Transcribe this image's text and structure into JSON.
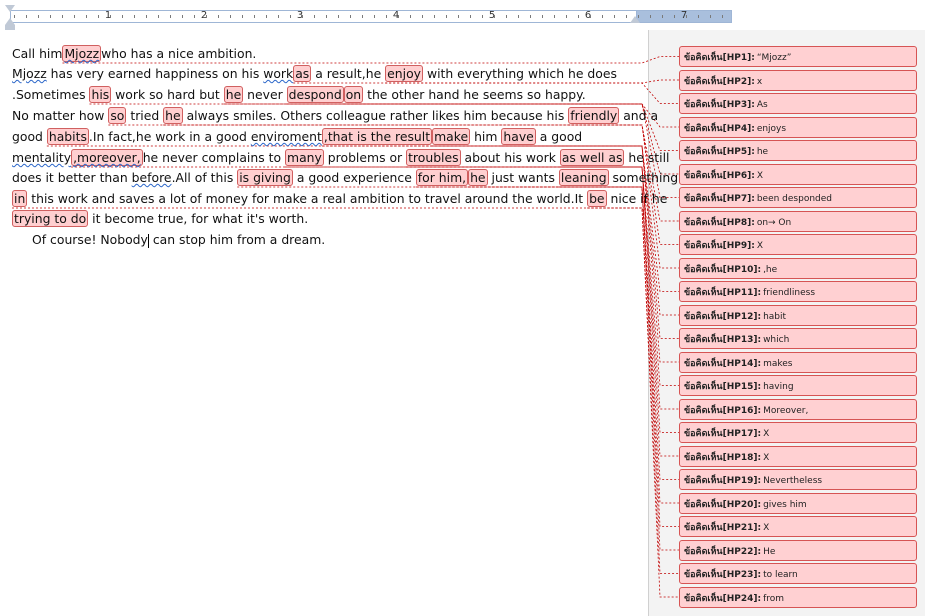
{
  "ruler": {
    "numbers": [
      "1",
      "2",
      "3",
      "4",
      "5",
      "6",
      "7"
    ]
  },
  "document": {
    "line1": {
      "a": "Call him",
      "b": "Mjozz",
      "c": "who has a nice ambition."
    },
    "line2": {
      "a": "Mjozz",
      "b": " has very earned happiness on his ",
      "c": "work",
      "d": "as",
      "e": " a result,he ",
      "f": "enjoy",
      "g": " with everything which he does"
    },
    "line3": {
      "a": ".Sometimes ",
      "b": "his",
      "c": " work so hard but ",
      "d": "he",
      "e": " never ",
      "f": "despond",
      "g": "on",
      "h": " the other hand he seems so happy."
    },
    "line4": {
      "a": "No matter how ",
      "b": "so",
      "c": " tried ",
      "d": "he",
      "e": " always smiles. Others colleague rather likes him because his ",
      "f": "friendly",
      "g": " and a"
    },
    "line5": {
      "a": "good ",
      "b": "habits",
      "c": ".In fact,he work in a good ",
      "d": "enviroment",
      "e": ",that is the result",
      "f": "make",
      "g": " him ",
      "h": "have",
      "i": " a good"
    },
    "line6": {
      "a": "mentality",
      "b": ",moreover,",
      "c": "he never complains to ",
      "d": "many",
      "e": " problems or ",
      "f": "troubles",
      "g": " about his work ",
      "h": "as well as",
      "i": " he still"
    },
    "line7": {
      "a": "does it better than ",
      "b": "before",
      "c": ".All of this ",
      "d": "is giving",
      "e": " a good experience ",
      "f": "for him,",
      "g": "he",
      "h": " just wants ",
      "i": "leaning",
      "j": " something"
    },
    "line8": {
      "a": "in",
      "b": " this work and saves a lot of money for make a real ambition to travel around the world.It ",
      "c": "be",
      "d": " nice if he"
    },
    "line9": {
      "a": "trying to do",
      "b": " it become true, for what it's worth."
    },
    "line10": {
      "a": "Of course! Nobody",
      "b": " can stop him from a dream."
    }
  },
  "comments": [
    {
      "label": "ข้อคิดเห็น[HP1]:",
      "text": "“Mjozz”"
    },
    {
      "label": "ข้อคิดเห็น[HP2]:",
      "text": "x"
    },
    {
      "label": "ข้อคิดเห็น[HP3]:",
      "text": "As"
    },
    {
      "label": "ข้อคิดเห็น[HP4]:",
      "text": "enjoys"
    },
    {
      "label": "ข้อคิดเห็น[HP5]:",
      "text": "he"
    },
    {
      "label": "ข้อคิดเห็น[HP6]:",
      "text": "X"
    },
    {
      "label": "ข้อคิดเห็น[HP7]:",
      "text": "been desponded"
    },
    {
      "label": "ข้อคิดเห็น[HP8]:",
      "text": "on→ On"
    },
    {
      "label": "ข้อคิดเห็น[HP9]:",
      "text": "X"
    },
    {
      "label": "ข้อคิดเห็น[HP10]:",
      "text": ",he"
    },
    {
      "label": "ข้อคิดเห็น[HP11]:",
      "text": "friendliness"
    },
    {
      "label": "ข้อคิดเห็น[HP12]:",
      "text": "habit"
    },
    {
      "label": "ข้อคิดเห็น[HP13]:",
      "text": "which"
    },
    {
      "label": "ข้อคิดเห็น[HP14]:",
      "text": "makes"
    },
    {
      "label": "ข้อคิดเห็น[HP15]:",
      "text": "having"
    },
    {
      "label": "ข้อคิดเห็น[HP16]:",
      "text": "Moreover,"
    },
    {
      "label": "ข้อคิดเห็น[HP17]:",
      "text": "X"
    },
    {
      "label": "ข้อคิดเห็น[HP18]:",
      "text": "X"
    },
    {
      "label": "ข้อคิดเห็น[HP19]:",
      "text": "Nevertheless"
    },
    {
      "label": "ข้อคิดเห็น[HP20]:",
      "text": "gives him"
    },
    {
      "label": "ข้อคิดเห็น[HP21]:",
      "text": "X"
    },
    {
      "label": "ข้อคิดเห็น[HP22]:",
      "text": "He"
    },
    {
      "label": "ข้อคิดเห็น[HP23]:",
      "text": "to learn"
    },
    {
      "label": "ข้อคิดเห็น[HP24]:",
      "text": "from"
    }
  ],
  "colors": {
    "highlight": "#ffcfd0",
    "comment_border": "#d65454",
    "connector": "#c00000",
    "markup_bg": "#f3f3f3"
  }
}
